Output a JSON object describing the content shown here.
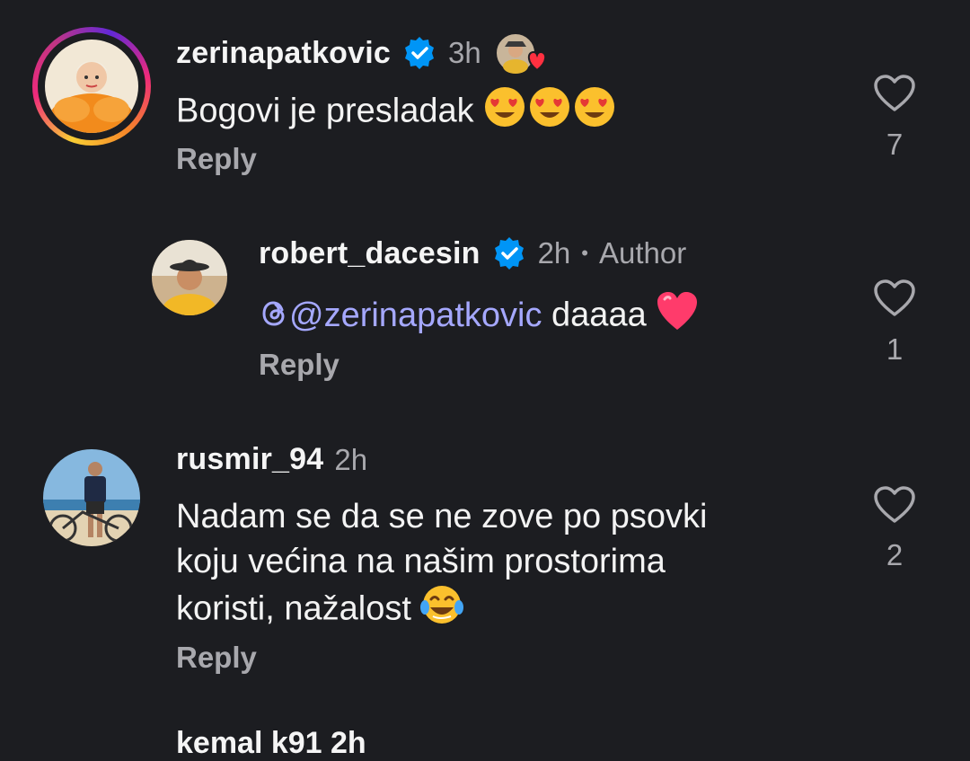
{
  "comments": [
    {
      "username": "zerinapatkovic",
      "time": "3h",
      "text": "Bogovi je presladak",
      "emoji": "😍😍😍",
      "reply_label": "Reply",
      "like_count": "7"
    },
    {
      "username": "robert_dacesin",
      "time": "2h",
      "badge": "Author",
      "mention": "@zerinapatkovic",
      "text": " daaaa",
      "reply_label": "Reply",
      "like_count": "1"
    },
    {
      "username": "rusmir_94",
      "time": "2h",
      "text_lines": [
        "Nadam se da se ne zove po psovki",
        "koju većina na našim prostorima",
        "koristi, nažalost"
      ],
      "reply_label": "Reply",
      "like_count": "2"
    }
  ],
  "next_comment_partial": "kemal k91 2h",
  "colors": {
    "background": "#1c1d21",
    "verified": "#0095f6",
    "mention": "#a5a8ff",
    "secondary_text": "#a8a8ad"
  },
  "icons": [
    "verified-badge-icon",
    "heart-outline-icon",
    "heart-filled-icon",
    "threads-icon"
  ]
}
